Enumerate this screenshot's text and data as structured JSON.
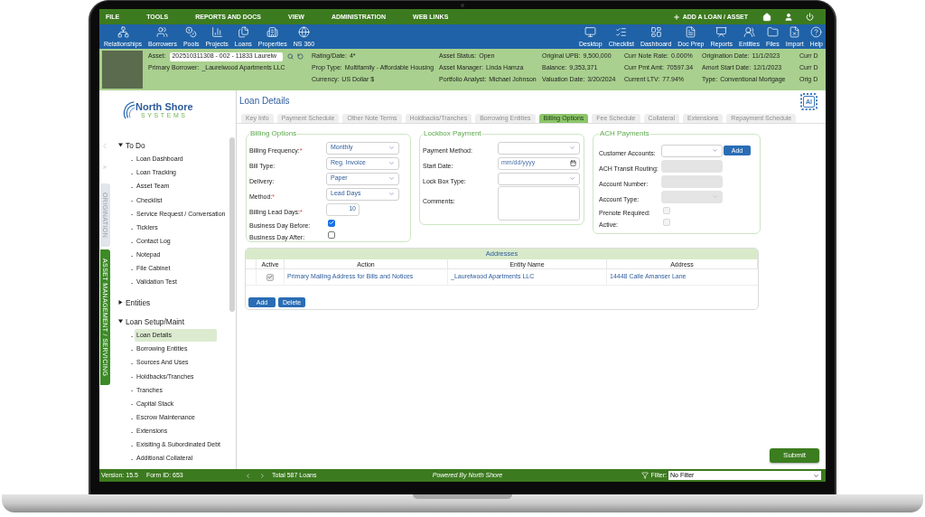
{
  "menu_bar": {
    "items": [
      "FILE",
      "TOOLS",
      "REPORTS AND DOCS",
      "VIEW",
      "ADMINISTRATION",
      "WEB LINKS"
    ],
    "add_button": "ADD A LOAN / ASSET"
  },
  "toolbar": {
    "left": [
      "Relationships",
      "Borrowers",
      "Pools",
      "Projects",
      "Loans",
      "Properties",
      "NS 360"
    ],
    "right": [
      "Desktop",
      "Checklist",
      "Dashboard",
      "Doc Prep",
      "Reports",
      "Entities",
      "Files",
      "Import",
      "Help"
    ]
  },
  "info_bar": {
    "asset": {
      "label": "Asset:",
      "value": "202510311308 - 002 - 11833 Laurelw"
    },
    "primary_borrower": {
      "label": "Primary Borrower:",
      "value": "_Laurelwood Apartments LLC"
    },
    "columns": [
      [
        {
          "label": "Rating/Date:",
          "value": "4*"
        },
        {
          "label": "Prop Type:",
          "value": "Multifamily - Affordable Housing"
        },
        {
          "label": "Currency:",
          "value": "US Dollar $"
        }
      ],
      [
        {
          "label": "Asset Status:",
          "value": "Open"
        },
        {
          "label": "Asset Manager:",
          "value": "Linda Hamza"
        },
        {
          "label": "Portfolio Analyst:",
          "value": "Michael Johnson"
        }
      ],
      [
        {
          "label": "Original UPB:",
          "value": "9,500,000"
        },
        {
          "label": "Balance:",
          "value": "9,353,371"
        },
        {
          "label": "Valuation Date:",
          "value": "3/20/2024"
        }
      ],
      [
        {
          "label": "Curr Note Rate:",
          "value": "0.000%"
        },
        {
          "label": "Curr Pmt Amt:",
          "value": "70597.34"
        },
        {
          "label": "Current LTV:",
          "value": "77.94%"
        }
      ],
      [
        {
          "label": "Origination Date:",
          "value": "11/1/2023"
        },
        {
          "label": "Amort Start Date:",
          "value": "12/1/2023"
        },
        {
          "label": "Type:",
          "value": "Conventional Mortgage"
        }
      ]
    ],
    "cut_column": [
      "Curr D",
      "Curr D",
      "Orig D"
    ]
  },
  "sidebar": {
    "logo": {
      "name": "North Shore",
      "tagline": "SYSTEMS"
    },
    "side_tabs": [
      {
        "label": "ORIGINATION",
        "selected": false
      },
      {
        "label": "ASSET MANAGEMENT / SERVICING",
        "selected": true
      }
    ],
    "tree": [
      {
        "label": "To Do",
        "expanded": true,
        "children": [
          {
            "bullet": "-",
            "label": "Loan Dashboard",
            "selected": false
          },
          {
            "bullet": "-",
            "label": "Loan Tracking",
            "selected": false
          },
          {
            "bullet": "-",
            "label": "Asset Team",
            "selected": false
          },
          {
            "bullet": "-",
            "label": "Checklist",
            "selected": false
          },
          {
            "bullet": "-",
            "label": "Service Request / Conversation",
            "selected": false
          },
          {
            "bullet": "-",
            "label": "Ticklers",
            "selected": false
          },
          {
            "bullet": "-",
            "label": "Contact Log",
            "selected": false
          },
          {
            "bullet": "-",
            "label": "Notepad",
            "selected": false
          },
          {
            "bullet": "-",
            "label": "File Cabinet",
            "selected": false
          },
          {
            "bullet": "-",
            "label": "Validation Test",
            "selected": false
          }
        ]
      },
      {
        "label": "Entities",
        "expanded": false
      },
      {
        "label": "Loan Setup/Maint",
        "expanded": true,
        "children": [
          {
            "bullet": "-",
            "label": "Loan Details",
            "selected": true
          },
          {
            "bullet": "-",
            "label": "Borrowing Entities",
            "selected": false
          },
          {
            "bullet": "-",
            "label": "Sources And Uses",
            "selected": false
          },
          {
            "bullet": "-",
            "label": "Holdbacks/Tranches",
            "selected": false
          },
          {
            "bullet": "-",
            "label": "Tranches",
            "selected": false
          },
          {
            "bullet": "-",
            "label": "Capital Stack",
            "selected": false
          },
          {
            "bullet": "-",
            "label": "Escrow Maintenance",
            "selected": false
          },
          {
            "bullet": "-",
            "label": "Extensions",
            "selected": false
          },
          {
            "bullet": "-",
            "label": "Exisiting & Subordinated Debt",
            "selected": false
          },
          {
            "bullet": "-",
            "label": "Additional Collateral",
            "selected": false
          }
        ]
      }
    ]
  },
  "page": {
    "title": "Loan Details",
    "ai_badge": "AI",
    "tabs": [
      {
        "label": "Key Info",
        "selected": false
      },
      {
        "label": "Payment Schedule",
        "selected": false
      },
      {
        "label": "Other Note Terms",
        "selected": false
      },
      {
        "label": "Holdbacks/Tranches",
        "selected": false
      },
      {
        "label": "Borrowing Entities",
        "selected": false
      },
      {
        "label": "Billing Options",
        "selected": true
      },
      {
        "label": "Fee Schedule",
        "selected": false
      },
      {
        "label": "Collateral",
        "selected": false
      },
      {
        "label": "Extensions",
        "selected": false
      },
      {
        "label": "Repayment Schedule",
        "selected": false
      }
    ]
  },
  "billing": {
    "legend": "Billing Options",
    "fields": [
      {
        "kind": "select",
        "label": "Billing Frequency:",
        "required_mark": "*",
        "value": "Monthly"
      },
      {
        "kind": "select",
        "label": "Bill Type:",
        "value": "Reg. Invoice"
      },
      {
        "kind": "select",
        "label": "Delivery:",
        "value": "Paper"
      },
      {
        "kind": "select",
        "label": "Method:",
        "required_mark": "*",
        "value": "Lead Days"
      },
      {
        "kind": "number",
        "label": "Billing Lead Days:",
        "required_mark": "*",
        "value": "10"
      },
      {
        "kind": "checkbox",
        "label": "Business Day Before:",
        "checked": true
      },
      {
        "kind": "checkbox",
        "label": "Business Day After:",
        "checked": false
      }
    ]
  },
  "lockbox": {
    "legend": "Lockbox Payment",
    "fields": [
      {
        "kind": "select",
        "label": "Payment Method:"
      },
      {
        "kind": "date",
        "label": "Start Date:",
        "placeholder": "mm/dd/yyyy"
      },
      {
        "kind": "select",
        "label": "Lock Box Type:"
      },
      {
        "kind": "textarea",
        "label": "Comments:"
      }
    ]
  },
  "ach": {
    "legend": "ACH Payments",
    "fields": [
      {
        "kind": "select",
        "label": "Customer Accounts:",
        "disabled": false,
        "button": "Add"
      },
      {
        "kind": "text",
        "label": "ACH Transit Routing:",
        "disabled": true
      },
      {
        "kind": "text",
        "label": "Account Number:",
        "disabled": true
      },
      {
        "kind": "select",
        "label": "Account Type:",
        "disabled": true
      },
      {
        "kind": "checkbox",
        "label": "Prenote Required:",
        "checked": false,
        "disabled": true
      },
      {
        "kind": "checkbox",
        "label": "Active:",
        "checked": false,
        "disabled": true
      }
    ]
  },
  "addresses": {
    "title": "Addresses",
    "columns": [
      "Active",
      "Action",
      "Entity Name",
      "Address"
    ],
    "rows": [
      {
        "active": true,
        "action": "Primary Mailing Address for Bills and Notices",
        "entity_name": "_Laurelwood Apartments LLC",
        "address": "14448 Calle Amanser Lane"
      }
    ],
    "buttons": [
      "Add",
      "Delete"
    ]
  },
  "submit": "Submit",
  "status_bar": {
    "version": "Version: 15.5",
    "form_id": "Form ID: 653",
    "total": "Total 587 Loans",
    "powered_by": "Powered By North Shore",
    "filter_label": "Filter:",
    "filter_value": "No Filter"
  }
}
